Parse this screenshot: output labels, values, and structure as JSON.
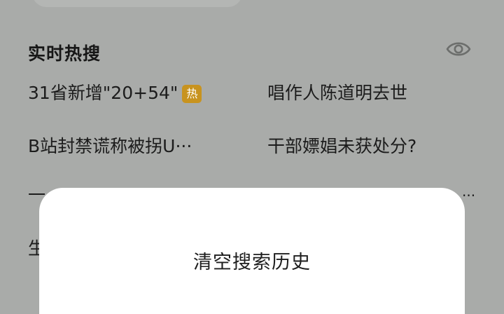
{
  "hot_search": {
    "title": "实时热搜",
    "visibility_icon": "eye-icon",
    "items": [
      {
        "text": "31省新增\"20+54\"",
        "badge": "热",
        "badge_color": "#c8931f"
      },
      {
        "text": "唱作人陈道明去世"
      },
      {
        "text": "B站封禁谎称被拐U···"
      },
      {
        "text": "干部嫖娼未获处分?"
      },
      {
        "text": "一",
        "note": "mostly hidden behind dialog"
      },
      {
        "text": "···"
      },
      {
        "text": "生"
      }
    ]
  },
  "dialog": {
    "title": "清空搜索历史"
  },
  "colors": {
    "backdrop": "#a9aba9",
    "dialog_bg": "#ffffff",
    "hot_badge": "#c8931f"
  }
}
